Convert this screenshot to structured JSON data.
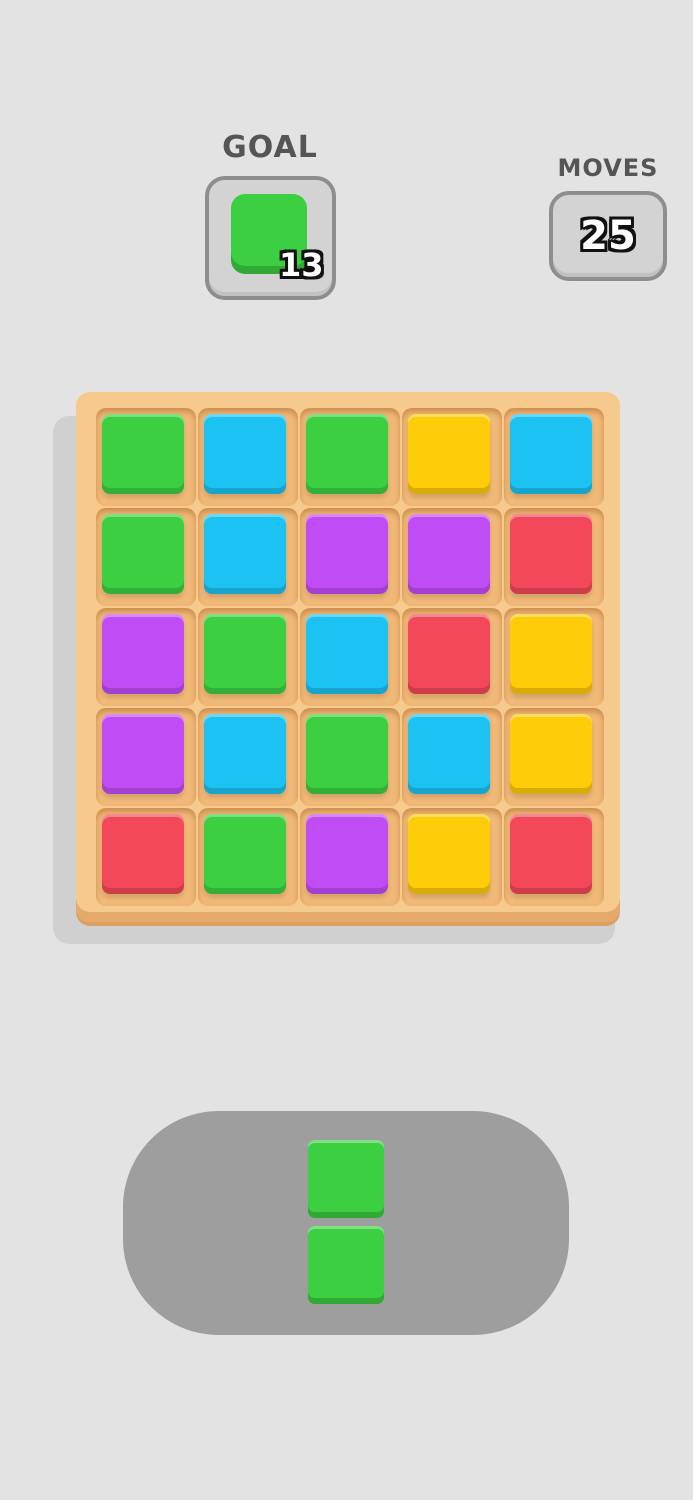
{
  "goal": {
    "label": "GOAL",
    "color": "green",
    "count": "13"
  },
  "moves": {
    "label": "MOVES",
    "count": "25"
  },
  "palette": {
    "green": "#3bcf41",
    "blue": "#1cc2f2",
    "yellow": "#ffcc0a",
    "purple": "#c04cf6",
    "red": "#f2485a"
  },
  "board": [
    [
      "green",
      "blue",
      "green",
      "yellow",
      "blue"
    ],
    [
      "green",
      "blue",
      "purple",
      "purple",
      "red"
    ],
    [
      "purple",
      "green",
      "blue",
      "red",
      "yellow"
    ],
    [
      "purple",
      "blue",
      "green",
      "blue",
      "yellow"
    ],
    [
      "red",
      "green",
      "purple",
      "yellow",
      "red"
    ]
  ],
  "next_piece": {
    "orientation": "vertical",
    "tiles": [
      "green",
      "green"
    ]
  }
}
